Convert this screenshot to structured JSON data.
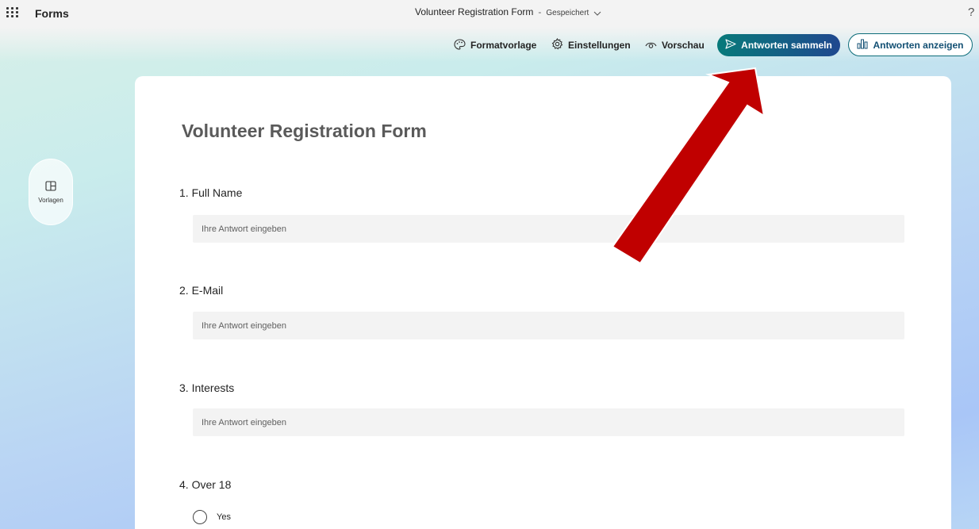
{
  "app": {
    "brand": "Forms",
    "doc_title": "Volunteer Registration Form",
    "separator": "-",
    "save_status": "Gespeichert",
    "help_symbol": "?"
  },
  "toolbar": {
    "style_label": "Formatvorlage",
    "settings_label": "Einstellungen",
    "preview_label": "Vorschau",
    "collect_label": "Antworten sammeln",
    "view_label": "Antworten anzeigen"
  },
  "side": {
    "templates_label": "Vorlagen"
  },
  "form": {
    "title": "Volunteer Registration Form",
    "questions": [
      {
        "title": "1. Full Name",
        "placeholder": "Ihre Antwort eingeben"
      },
      {
        "title": "2. E-Mail",
        "placeholder": "Ihre Antwort eingeben"
      },
      {
        "title": "3. Interests",
        "placeholder": "Ihre Antwort eingeben"
      },
      {
        "title": "4. Over 18",
        "options": [
          "Yes"
        ]
      }
    ]
  },
  "colors": {
    "accent_start": "#077a7a",
    "accent_end": "#20488f",
    "annotation_arrow": "#c00000"
  },
  "icons": {
    "app_launcher": "waffle-icon",
    "style": "palette-icon",
    "settings": "gear-icon",
    "preview": "eye-icon",
    "collect": "send-icon",
    "view": "chart-icon",
    "templates": "layout-icon"
  }
}
